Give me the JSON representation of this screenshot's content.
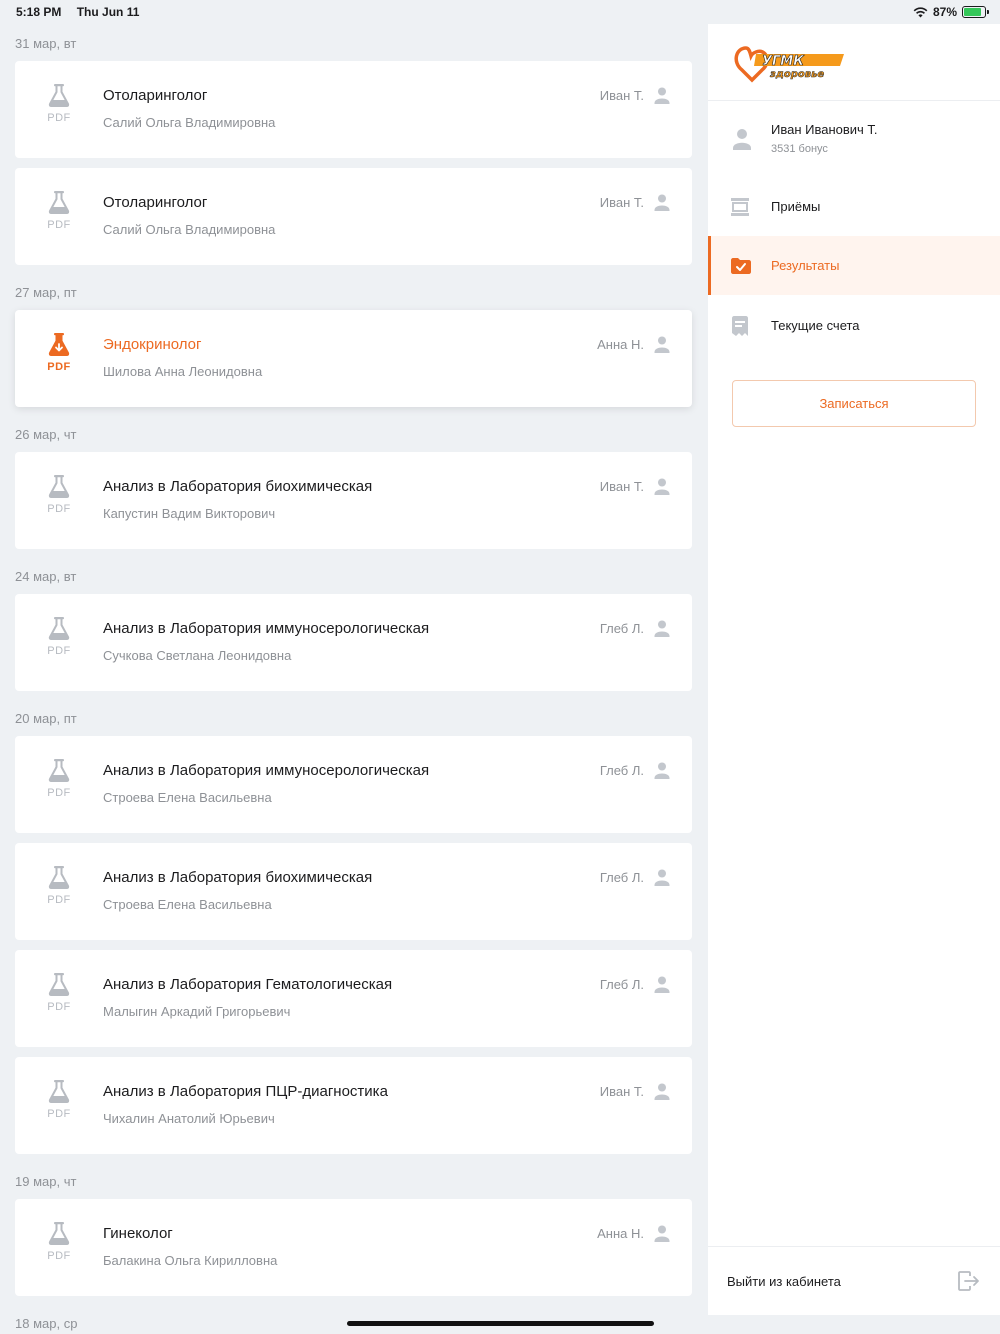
{
  "status_bar": {
    "time": "5:18 PM",
    "date": "Thu Jun 11",
    "battery_percent": "87%",
    "battery_level": 0.87
  },
  "results": {
    "groups": [
      {
        "date": "31 мар, вт",
        "items": [
          {
            "title": "Отоларинголог",
            "doctor": "Салий Ольга Владимировна",
            "patient": "Иван Т.",
            "file_label": "PDF",
            "active": false
          },
          {
            "title": "Отоларинголог",
            "doctor": "Салий Ольга Владимировна",
            "patient": "Иван Т.",
            "file_label": "PDF",
            "active": false
          }
        ]
      },
      {
        "date": "27 мар, пт",
        "items": [
          {
            "title": "Эндокринолог",
            "doctor": "Шилова Анна Леонидовна",
            "patient": "Анна Н.",
            "file_label": "PDF",
            "active": true
          }
        ]
      },
      {
        "date": "26 мар, чт",
        "items": [
          {
            "title": "Анализ в Лаборатория биохимическая",
            "doctor": "Капустин Вадим Викторович",
            "patient": "Иван Т.",
            "file_label": "PDF",
            "active": false
          }
        ]
      },
      {
        "date": "24 мар, вт",
        "items": [
          {
            "title": "Анализ в Лаборатория иммуносерологическая",
            "doctor": "Сучкова Светлана Леонидовна",
            "patient": "Глеб Л.",
            "file_label": "PDF",
            "active": false
          }
        ]
      },
      {
        "date": "20 мар, пт",
        "items": [
          {
            "title": "Анализ в Лаборатория иммуносерологическая",
            "doctor": "Строева Елена Васильевна",
            "patient": "Глеб Л.",
            "file_label": "PDF",
            "active": false
          },
          {
            "title": "Анализ в Лаборатория биохимическая",
            "doctor": "Строева Елена Васильевна",
            "patient": "Глеб Л.",
            "file_label": "PDF",
            "active": false
          },
          {
            "title": "Анализ в Лаборатория Гематологическая",
            "doctor": "Малыгин Аркадий Григорьевич",
            "patient": "Глеб Л.",
            "file_label": "PDF",
            "active": false
          },
          {
            "title": "Анализ в Лаборатория ПЦР-диагностика",
            "doctor": "Чихалин Анатолий Юрьевич",
            "patient": "Иван Т.",
            "file_label": "PDF",
            "active": false
          }
        ]
      },
      {
        "date": "19 мар, чт",
        "items": [
          {
            "title": "Гинеколог",
            "doctor": "Балакина Ольга Кирилловна",
            "patient": "Анна Н.",
            "file_label": "PDF",
            "active": false
          }
        ]
      },
      {
        "date": "18 мар, ср",
        "items": []
      }
    ]
  },
  "sidebar": {
    "logo_text_top": "УГМК",
    "logo_text_bottom": "здоровье",
    "user": {
      "name": "Иван Иванович Т.",
      "bonus": "3531 бонус"
    },
    "menu": [
      {
        "label": "Приёмы",
        "icon": "appointments-icon",
        "selected": false
      },
      {
        "label": "Результаты",
        "icon": "folder-check-icon",
        "selected": true
      },
      {
        "label": "Текущие счета",
        "icon": "receipt-icon",
        "selected": false
      }
    ],
    "book_button": "Записаться",
    "logout": "Выйти из кабинета"
  },
  "colors": {
    "accent": "#ec6a22",
    "background": "#eef1f4",
    "muted_text": "#8e9196",
    "icon_gray": "#b7bbc1"
  }
}
